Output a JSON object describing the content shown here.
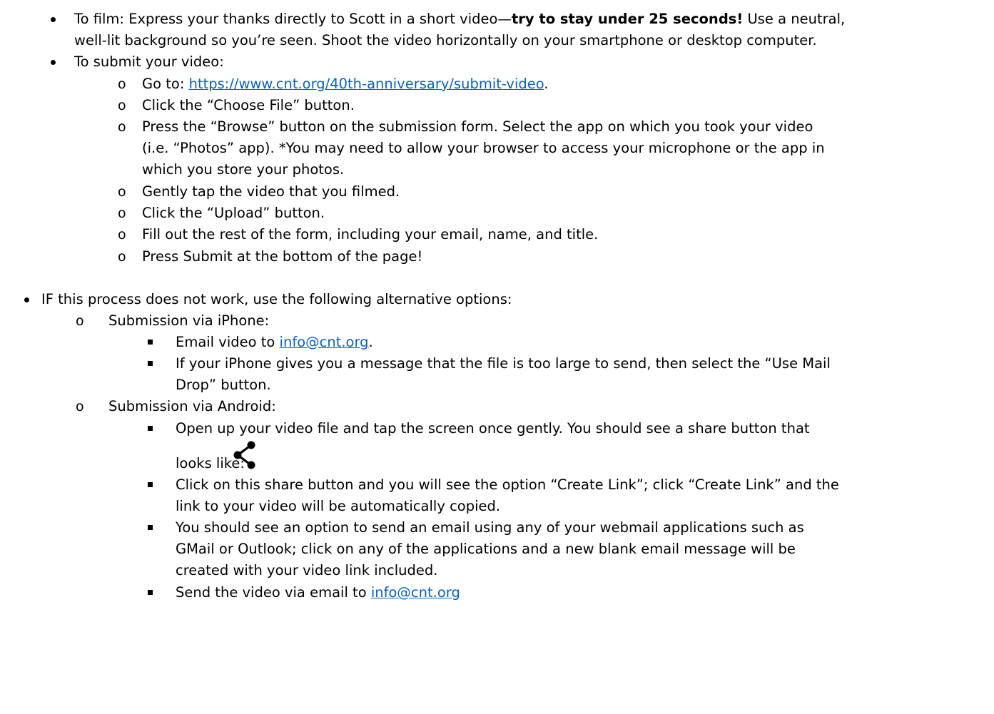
{
  "film": {
    "line1_a": "To film: Express your thanks directly to Scott in a short video—",
    "line1_bold": "try to stay under 25 seconds!",
    "line1_b": " Use a neutral,",
    "line2": "well-lit background so you’re seen. Shoot the video horizontally on your smartphone or desktop computer."
  },
  "submit": {
    "heading": "To submit your video:",
    "step1_prefix": "Go to: ",
    "step1_link": "https://www.cnt.org/40th-anniversary/submit-video",
    "step1_suffix": ".",
    "step2": "Click the “Choose File” button.",
    "step3_line1": "Press the “Browse” button on the submission form. Select the app on which you took your video",
    "step3_line2": "(i.e. “Photos” app). *You may need to allow your browser to access your microphone or the app in",
    "step3_line3": "which you store your photos.",
    "step4": "Gently tap the video that you filmed.",
    "step5": "Click the “Upload” button.",
    "step6": "Fill out the rest of the form, including your email, name, and title.",
    "step7": "Press Submit at the bottom of the page!"
  },
  "alternative": {
    "heading": "IF this process does not work, use the following alternative options:",
    "iphone": {
      "heading": "Submission via iPhone:",
      "item1_prefix": "Email video to ",
      "item1_link": "info@cnt.org",
      "item1_suffix": ".",
      "item2_line1": "If your iPhone gives you a message that the file is too large to send, then select the “Use Mail",
      "item2_line2": "Drop” button."
    },
    "android": {
      "heading": "Submission via Android:",
      "item1_line1": "Open up your video file and tap the screen once gently. You should see a share button that",
      "item1_line2": "looks like:",
      "share_icon": "share-icon",
      "item2_line1": "Click on this share button and you will see the option “Create Link”; click “Create Link” and the",
      "item2_line2": "link to your video will be automatically copied.",
      "item3_line1": "You should see an option to send an email using any of your webmail applications such as",
      "item3_line2": "GMail or Outlook; click on any of the applications and a new blank email message will be",
      "item3_line3": "created with your video link included.",
      "item4_prefix": "Send the video via email to ",
      "item4_link": "info@cnt.org"
    }
  },
  "colors": {
    "link": "#0563c1",
    "text": "#000000"
  }
}
